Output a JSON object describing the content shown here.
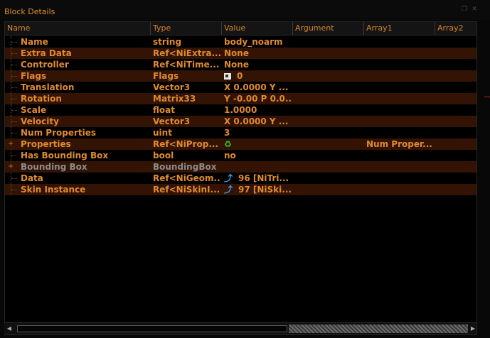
{
  "window": {
    "title": "Block Details"
  },
  "columns": [
    "Name",
    "Type",
    "Value",
    "Argument",
    "Array1",
    "Array2"
  ],
  "rows": [
    {
      "name": "Name",
      "type": "string",
      "value": "body_noarm",
      "array1": "",
      "icon": "",
      "expand": "",
      "dim": false
    },
    {
      "name": "Extra Data",
      "type": "Ref<NiExtra...",
      "value": "None",
      "array1": "",
      "icon": "",
      "expand": "",
      "dim": false
    },
    {
      "name": "Controller",
      "type": "Ref<NiTime...",
      "value": "None",
      "array1": "",
      "icon": "",
      "expand": "",
      "dim": false
    },
    {
      "name": "Flags",
      "type": "Flags",
      "value": "0",
      "array1": "",
      "icon": "flag-icon",
      "expand": "",
      "dim": false
    },
    {
      "name": "Translation",
      "type": "Vector3",
      "value": "X 0.0000 Y ...",
      "array1": "",
      "icon": "",
      "expand": "",
      "dim": false
    },
    {
      "name": "Rotation",
      "type": "Matrix33",
      "value": "Y -0.00 P 0.0...",
      "array1": "",
      "icon": "",
      "expand": "",
      "dim": false
    },
    {
      "name": "Scale",
      "type": "float",
      "value": "1.0000",
      "array1": "",
      "icon": "",
      "expand": "",
      "dim": false
    },
    {
      "name": "Velocity",
      "type": "Vector3",
      "value": "X 0.0000 Y ...",
      "array1": "",
      "icon": "",
      "expand": "",
      "dim": false
    },
    {
      "name": "Num Properties",
      "type": "uint",
      "value": "3",
      "array1": "",
      "icon": "",
      "expand": "",
      "dim": false
    },
    {
      "name": "Properties",
      "type": "Ref<NiProp...",
      "value": "",
      "array1": "Num Proper...",
      "icon": "recycle-icon",
      "expand": "+",
      "dim": false
    },
    {
      "name": "Has Bounding Box",
      "type": "bool",
      "value": "no",
      "array1": "",
      "icon": "",
      "expand": "",
      "dim": false
    },
    {
      "name": "Bounding Box",
      "type": "BoundingBox",
      "value": "",
      "array1": "",
      "icon": "",
      "expand": "+",
      "dim": true
    },
    {
      "name": "Data",
      "type": "Ref<NiGeom...",
      "value": "96 [NiTri...",
      "array1": "",
      "icon": "link-icon",
      "expand": "",
      "dim": false
    },
    {
      "name": "Skin Instance",
      "type": "Ref<NiSkinI...",
      "value": "97 [NiSki...",
      "array1": "",
      "icon": "link-icon",
      "expand": "",
      "dim": false
    }
  ],
  "colors": {
    "accent": "#e08a30",
    "alt_row": "#331303",
    "background": "#000000",
    "dim_text": "#8c8c8c"
  }
}
